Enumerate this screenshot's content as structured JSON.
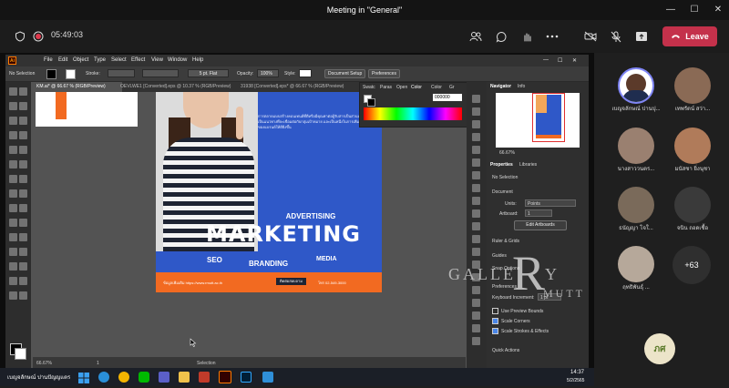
{
  "window": {
    "title": "Meeting in \"General\"",
    "minimize": "—",
    "maximize": "☐",
    "close": "✕"
  },
  "meeting": {
    "timer": "05:49:03",
    "leave_label": "Leave",
    "toolbar_icons": [
      "shield-icon",
      "record-icon",
      "people-icon",
      "chat-icon",
      "raise-hand-icon",
      "more-icon",
      "camera-off-icon",
      "mic-off-icon",
      "share-icon",
      "phone-icon"
    ]
  },
  "illustrator": {
    "app_badge": "Ai",
    "menu": [
      "File",
      "Edit",
      "Object",
      "Type",
      "Select",
      "Effect",
      "View",
      "Window",
      "Help"
    ],
    "control": {
      "selection": "No Selection",
      "stroke_label": "Stroke:",
      "brush": "5 pt. Flat",
      "opacity_label": "Opacity:",
      "opacity_value": "100%",
      "style_label": "Style:",
      "doc_setup": "Document Setup",
      "preferences": "Preferences"
    },
    "doc_tabs": [
      "KM.ai* @ 66.67 % (RGB/Preview)",
      "OEVLWE1 [Converted].eps @ 10.37 % (RGB/Preview)",
      "31938 [Converted].eps* @ 66.67 % (RGB/Preview)"
    ],
    "color_panel": {
      "tabs": [
        "Swatc",
        "Paras",
        "Open",
        "Color",
        "Color",
        "Gr"
      ],
      "hex": "000000"
    },
    "right_panel": {
      "tabs": [
        "Navigator",
        "Info"
      ],
      "zoom": "66.67%",
      "prop_tabs": [
        "Properties",
        "Libraries"
      ],
      "no_selection": "No Selection",
      "document_label": "Document",
      "units_label": "Units:",
      "units_value": "Points",
      "artboard_label": "Artboard:",
      "artboard_value": "1",
      "edit_artboards": "Edit Artboards",
      "rulers_grids": "Ruler & Grids",
      "guides": "Guides",
      "snap_options": "Snap Options",
      "preferences": "Preferences",
      "keyboard_increment": "Keyboard Increment:",
      "keyboard_value": "1 pt",
      "checks": [
        {
          "label": "Use Preview Bounds",
          "on": false
        },
        {
          "label": "Scale Corners",
          "on": true
        },
        {
          "label": "Scale Strokes & Effects",
          "on": true
        }
      ],
      "quick_actions": "Quick Actions"
    },
    "status": {
      "zoom": "66.67%",
      "artboard": "1",
      "tool": "Selection"
    },
    "artwork": {
      "body": "การตลาดแบบสร้างคอนเทนต์ที่ดีหรือมีคุณค่าต่อผู้รับสารเป็นส่วนหนึ่ง ในการเป็นแนวทางที่จะเชื่อมต่อกับกลุ่มเป้าหมาย และเป็นหนึ่งในการเพิ่มศักยภาพของแบรนด์ให้ดียิ่งขึ้น",
      "advertising": "ADVERTISING",
      "marketing": "MARKETING",
      "seo": "SEO",
      "branding": "BRANDING",
      "media": "MEDIA",
      "footer_url": "ข้อมูลเพิ่มเติม https://www.rmutt.ac.th",
      "footer_badge": "ติดต่อสอบถาม",
      "footer_right": "โทร 02-549-3000"
    }
  },
  "watermark": {
    "line1": "GALLE",
    "big_r": "R",
    "line1_end": "Y",
    "line2": "MUTT"
  },
  "taskbar": {
    "user": "เบญจลักษณ์ ปานปัญญแตร",
    "time": "14:37",
    "date": "5/2/2565"
  },
  "participants": [
    {
      "name": "เบญจลักษณ์ ปานปุ...",
      "color": "#5b6f9a",
      "active": true
    },
    {
      "name": "เทพรัตน์ สว่า...",
      "color": "#8a6a55"
    },
    {
      "name": "นางสาววนตร...",
      "color": "#9a8070"
    },
    {
      "name": "มนัสชา ยิ่งนุชา",
      "color": "#b07b5a"
    },
    {
      "name": "ธนัญญา โจใ...",
      "color": "#7a6a5a"
    },
    {
      "name": "จนิน ถอดเชื้อ",
      "color": "#3a3a3a"
    },
    {
      "name": "ฤทธิพันธุ์ ...",
      "color": "#b6a89a"
    }
  ],
  "more_count": "+63",
  "self_initials": "ภศ"
}
